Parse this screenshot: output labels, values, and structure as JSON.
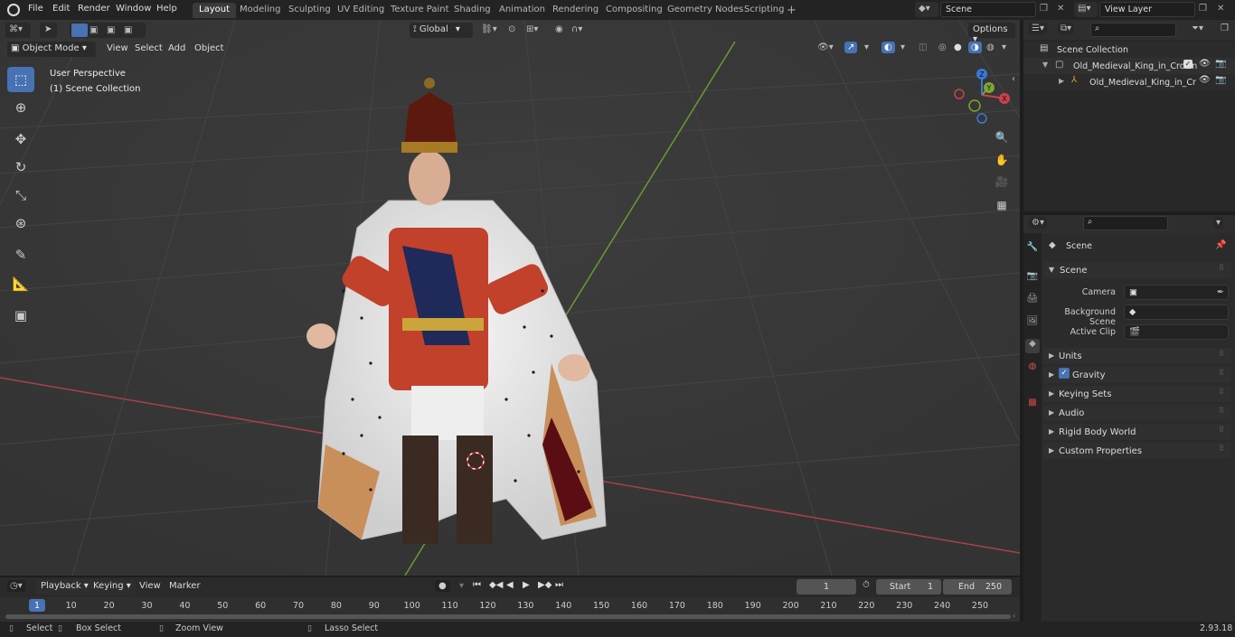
{
  "menu": {
    "file": "File",
    "edit": "Edit",
    "render": "Render",
    "window": "Window",
    "help": "Help"
  },
  "workspaces": [
    "Layout",
    "Modeling",
    "Sculpting",
    "UV Editing",
    "Texture Paint",
    "Shading",
    "Animation",
    "Rendering",
    "Compositing",
    "Geometry Nodes",
    "Scripting"
  ],
  "active_workspace": "Layout",
  "scene_field": "Scene",
  "view_layer_field": "View Layer",
  "transform_orientation": "Global",
  "options_label": "Options",
  "viewport_header": {
    "mode": "Object Mode",
    "view": "View",
    "select": "Select",
    "add": "Add",
    "object": "Object"
  },
  "viewport_overlay": {
    "perspective": "User Perspective",
    "collection": "(1) Scene Collection"
  },
  "gizmo": {
    "x": "X",
    "y": "Y",
    "z": "Z"
  },
  "outliner": {
    "root": "Scene Collection",
    "item1": "Old_Medieval_King_in_Crown",
    "item2": "Old_Medieval_King_in_Cr"
  },
  "properties": {
    "context": "Scene",
    "panel": "Scene",
    "camera_label": "Camera",
    "background_scene_label": "Background Scene",
    "active_clip_label": "Active Clip",
    "sections": [
      "Units",
      "Gravity",
      "Keying Sets",
      "Audio",
      "Rigid Body World",
      "Custom Properties"
    ]
  },
  "timeline": {
    "playback": "Playback",
    "keying": "Keying",
    "view": "View",
    "marker": "Marker",
    "current_frame": "1",
    "start_label": "Start",
    "start": "1",
    "end_label": "End",
    "end": "250",
    "ruler": [
      "1",
      "10",
      "20",
      "30",
      "40",
      "50",
      "60",
      "70",
      "80",
      "90",
      "100",
      "110",
      "120",
      "130",
      "140",
      "150",
      "160",
      "170",
      "180",
      "190",
      "200",
      "210",
      "220",
      "230",
      "240",
      "250"
    ]
  },
  "status": {
    "select": "Select",
    "box_select": "Box Select",
    "zoom_view": "Zoom View",
    "lasso_select": "Lasso Select",
    "version": "2.93.18"
  },
  "colors": {
    "accent": "#4772b3",
    "x_axis": "#c9424d",
    "y_axis": "#7da531",
    "z_axis": "#3a79d6"
  }
}
